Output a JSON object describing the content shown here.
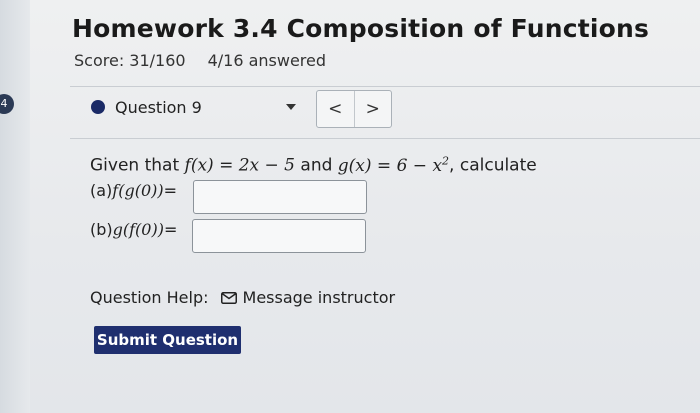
{
  "assignment": {
    "title": "Homework 3.4 Composition of Functions",
    "score": "Score: 31/160",
    "answered": "4/16 answered"
  },
  "left_badge": "4",
  "question_nav": {
    "selected": "Question 9",
    "prev": "<",
    "next": ">"
  },
  "problem": {
    "prefix": "Given that ",
    "f_def": "f(x) = 2x − 5",
    "connector": " and ",
    "g_def_main": "g(x) = 6 − x",
    "g_def_exp": "2",
    "suffix": ", calculate",
    "part_a_label": "(a) ",
    "part_a_expr": "f(g(0))",
    "part_a_eq": "=",
    "part_b_label": "(b) ",
    "part_b_expr": "g(f(0))",
    "part_b_eq": "=",
    "part_a_value": "",
    "part_b_value": ""
  },
  "help": {
    "label": "Question Help:",
    "message": "Message instructor"
  },
  "submit_label": "Submit Question",
  "colors": {
    "accent": "#1f2f6f",
    "dot": "#1a2a66"
  }
}
